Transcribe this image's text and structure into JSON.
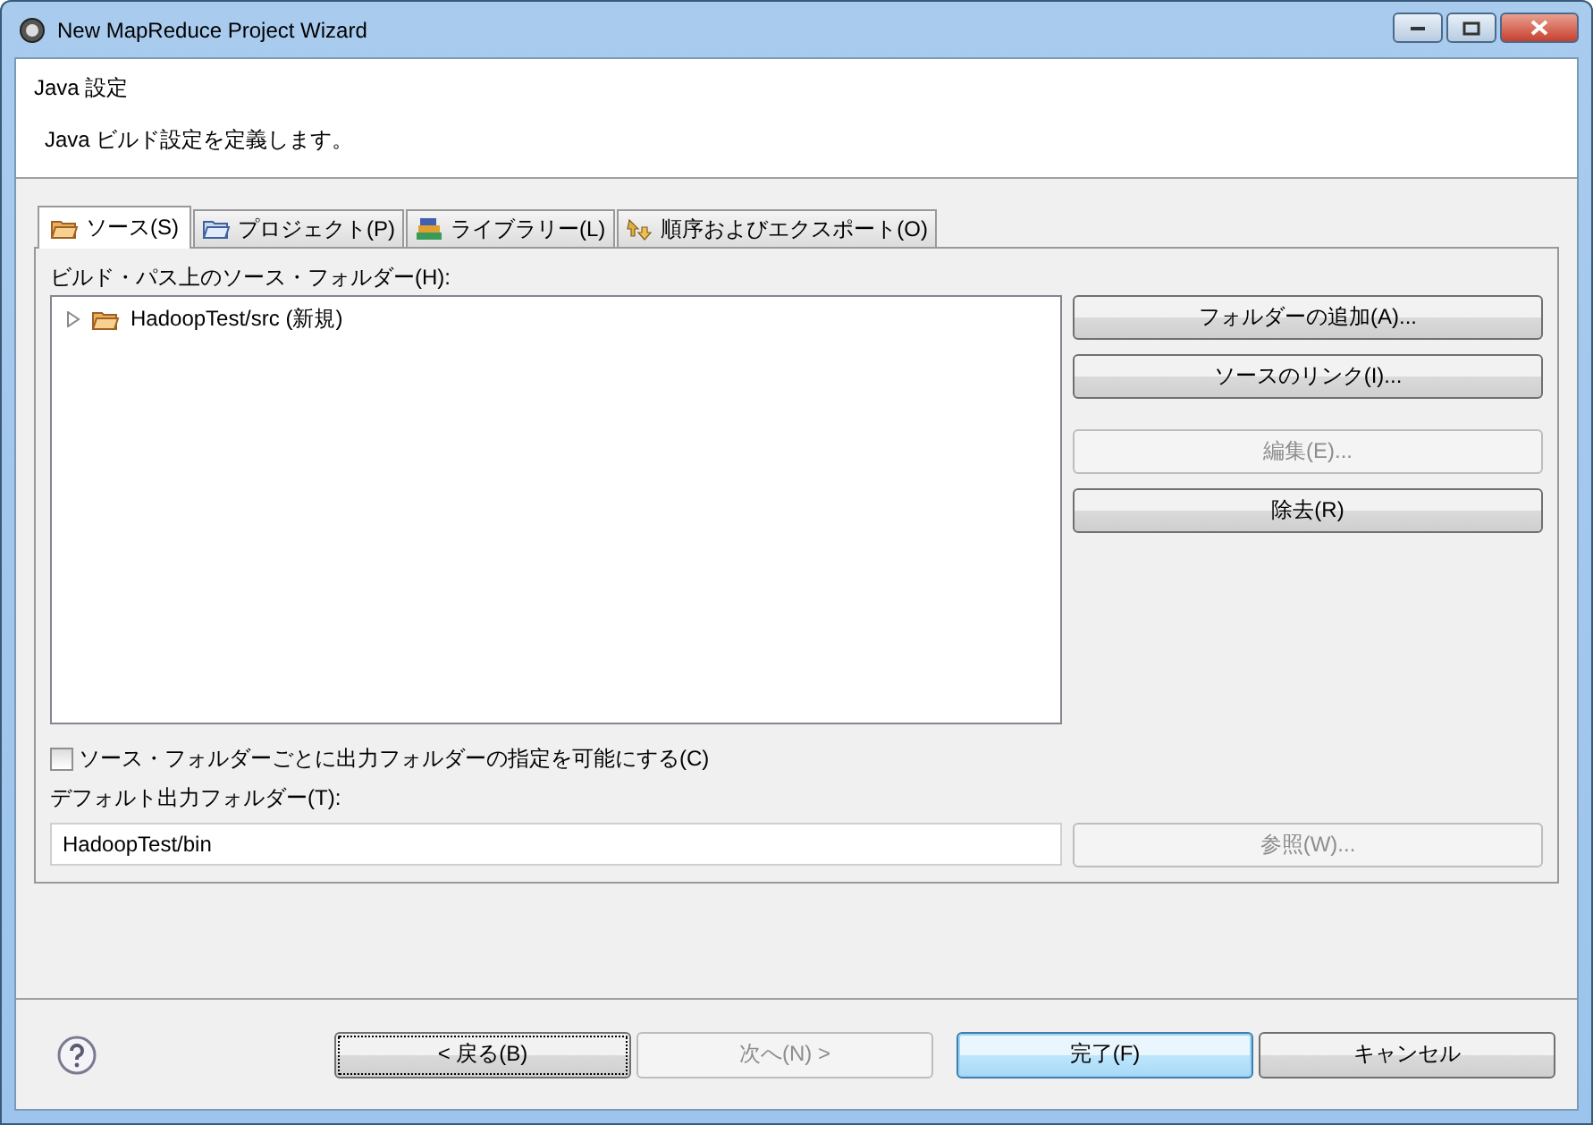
{
  "window": {
    "title": "New MapReduce Project Wizard"
  },
  "header": {
    "title": "Java 設定",
    "description": "Java ビルド設定を定義します。"
  },
  "tabs": [
    {
      "label": "ソース(S)",
      "selected": true
    },
    {
      "label": "プロジェクト(P)",
      "selected": false
    },
    {
      "label": "ライブラリー(L)",
      "selected": false
    },
    {
      "label": "順序およびエクスポート(O)",
      "selected": false
    }
  ],
  "source_folders": {
    "label": "ビルド・パス上のソース・フォルダー(H):",
    "items": [
      {
        "label": "HadoopTest/src (新規)",
        "expanded": false
      }
    ]
  },
  "side_button_groups": [
    [
      {
        "label": "フォルダーの追加(A)...",
        "disabled": false
      },
      {
        "label": "ソースのリンク(I)...",
        "disabled": false
      }
    ],
    [
      {
        "label": "編集(E)...",
        "disabled": true
      },
      {
        "label": "除去(R)",
        "disabled": false
      }
    ]
  ],
  "per_folder_output": {
    "label": "ソース・フォルダーごとに出力フォルダーの指定を可能にする(C)",
    "checked": false
  },
  "default_output": {
    "label": "デフォルト出力フォルダー(T):",
    "value": "HadoopTest/bin",
    "browse": {
      "label": "参照(W)...",
      "disabled": true
    }
  },
  "footer_buttons": [
    {
      "label": "< 戻る(B)",
      "disabled": false,
      "default": false,
      "focused": true
    },
    {
      "label": "次へ(N) >",
      "disabled": true,
      "default": false,
      "focused": false
    },
    {
      "label": "完了(F)",
      "disabled": false,
      "default": true,
      "focused": false
    },
    {
      "label": "キャンセル",
      "disabled": false,
      "default": false,
      "focused": false
    }
  ]
}
